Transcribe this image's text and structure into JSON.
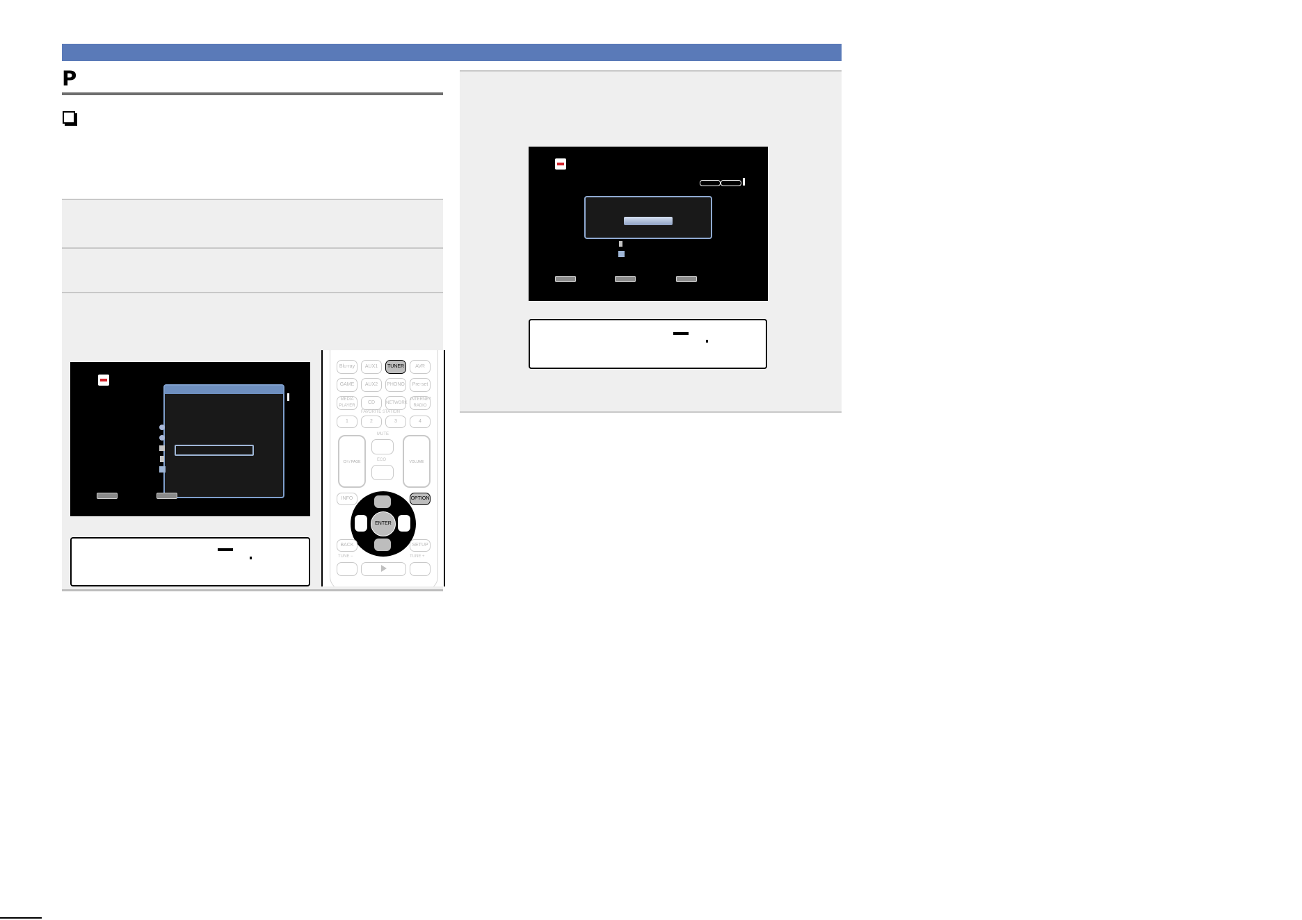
{
  "header": {
    "title": "P"
  },
  "remote": {
    "keys_row1": [
      "Blu-ray",
      "AUX1",
      "TUNER",
      "AVR"
    ],
    "keys_row2": [
      "GAME",
      "AUX2",
      "PHONO",
      "Pre-set"
    ],
    "keys_row3": [
      "MEDIA PLAYER",
      "CD",
      "NETWORK",
      "INTERNET RADIO"
    ],
    "favorite_label": "FAVORITE STATION",
    "numbers": [
      "1",
      "2",
      "3",
      "4"
    ],
    "mute_label": "MUTE",
    "ch_page_label": "CH / PAGE",
    "volume_label": "VOLUME",
    "eco_label": "ECO",
    "info_label": "INFO",
    "option_label": "OPTION",
    "enter_label": "ENTER",
    "back_label": "BACK",
    "setup_label": "SETUP",
    "tune_minus_label": "TUNE −",
    "tune_plus_label": "TUNE +"
  }
}
